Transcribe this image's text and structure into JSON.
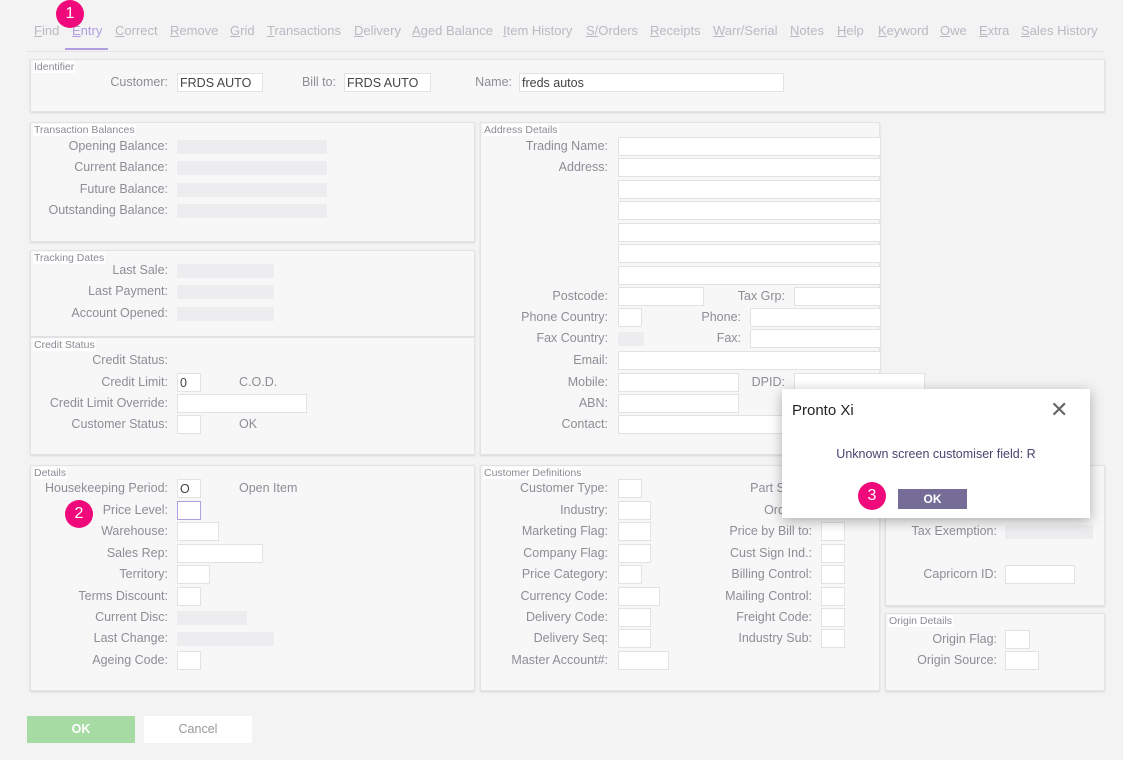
{
  "tabs": [
    "Find",
    "Entry",
    "Correct",
    "Remove",
    "Grid",
    "Transactions",
    "Delivery",
    "Aged Balance",
    "Item History",
    "S/Orders",
    "Receipts",
    "Warr/Serial",
    "Notes",
    "Help",
    "Keyword",
    "Owe",
    "Extra",
    "Sales History"
  ],
  "active_tab": "Entry",
  "panels": [
    {
      "title": "Identifier",
      "fields": [
        {
          "label": "Customer:",
          "value": "FRDS AUTO"
        },
        {
          "label": "Bill to:",
          "value": "FRDS AUTO"
        },
        {
          "label": "Name:",
          "value": "freds autos"
        }
      ]
    },
    {
      "title": "Transaction Balances",
      "fields": [
        {
          "label": "Opening Balance:"
        },
        {
          "label": "Current Balance:"
        },
        {
          "label": "Future Balance:"
        },
        {
          "label": "Outstanding Balance:"
        }
      ]
    },
    {
      "title": "Tracking Dates",
      "fields": [
        {
          "label": "Last Sale:"
        },
        {
          "label": "Last Payment:"
        },
        {
          "label": "Account Opened:"
        }
      ]
    },
    {
      "title": "Credit Status",
      "fields": [
        {
          "label": "Credit Status:"
        },
        {
          "label": "Credit Limit:",
          "value": "0",
          "note": "C.O.D."
        },
        {
          "label": "Credit Limit Override:"
        },
        {
          "label": "Customer Status:",
          "note": "OK"
        }
      ]
    },
    {
      "title": "Details",
      "fields": [
        {
          "label": "Housekeeping Period:",
          "value": "O",
          "note": "Open Item"
        },
        {
          "label": "Price Level:"
        },
        {
          "label": "Warehouse:"
        },
        {
          "label": "Sales Rep:"
        },
        {
          "label": "Territory:"
        },
        {
          "label": "Terms Discount:"
        },
        {
          "label": "Current Disc:"
        },
        {
          "label": "Last Change:"
        },
        {
          "label": "Ageing Code:"
        }
      ]
    },
    {
      "title": "Address Details",
      "fields": [
        {
          "label": "Trading Name:"
        },
        {
          "label": "Address:"
        },
        {
          "label": ""
        },
        {
          "label": ""
        },
        {
          "label": ""
        },
        {
          "label": ""
        },
        {
          "label": ""
        },
        {
          "label": "Postcode:"
        },
        {
          "label": "Tax Grp:"
        },
        {
          "label": "Phone Country:"
        },
        {
          "label": "Phone:"
        },
        {
          "label": "Fax Country:"
        },
        {
          "label": "Fax:"
        },
        {
          "label": "Email:"
        },
        {
          "label": "Mobile:"
        },
        {
          "label": "DPID:"
        },
        {
          "label": "ABN:"
        },
        {
          "label": "Contact:"
        }
      ]
    },
    {
      "title": "Customer Definitions",
      "fields": [
        {
          "label": "Customer Type:"
        },
        {
          "label": "Industry:"
        },
        {
          "label": "Marketing Flag:"
        },
        {
          "label": "Company Flag:"
        },
        {
          "label": "Price Category:"
        },
        {
          "label": "Currency Code:"
        },
        {
          "label": "Delivery Code:"
        },
        {
          "label": "Delivery Seq:"
        },
        {
          "label": "Master Account#:"
        },
        {
          "label": "Part Shipm"
        },
        {
          "label": "Order Pr"
        },
        {
          "label": "Price by Bill to:"
        },
        {
          "label": "Cust Sign Ind.:"
        },
        {
          "label": "Billing Control:"
        },
        {
          "label": "Mailing Control:"
        },
        {
          "label": "Freight Code:"
        },
        {
          "label": "Industry Sub:"
        }
      ]
    },
    {
      "title": "",
      "fields": [
        {
          "label": "Tax Exemption:"
        },
        {
          "label": "Capricorn ID:"
        }
      ]
    },
    {
      "title": "Origin Details",
      "fields": [
        {
          "label": "Origin Flag:"
        },
        {
          "label": "Origin Source:"
        }
      ]
    }
  ],
  "footer": {
    "ok": "OK",
    "cancel": "Cancel"
  },
  "dialog": {
    "title": "Pronto Xi",
    "message": "Unknown screen customiser field: R",
    "ok": "OK"
  },
  "badges": [
    "1",
    "2",
    "3"
  ],
  "colors": {
    "accent": "#b09ee0",
    "badge": "#f0097a",
    "ok_green": "#a6dba3",
    "dialog_button": "#756d98"
  }
}
